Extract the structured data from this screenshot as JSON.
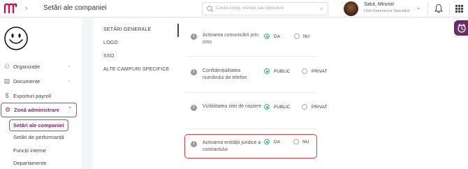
{
  "header": {
    "title": "Setări ale companiei",
    "search_placeholder": "Caută coleg, echipe sau obiective",
    "greeting": "Salut, Miruna!",
    "role": "User Experience Specialist"
  },
  "sidebar": {
    "items": [
      {
        "label": "Organizație",
        "icon": "people-icon"
      },
      {
        "label": "Documente",
        "icon": "document-icon"
      },
      {
        "label": "Exporturi payroll",
        "icon": "dollar-icon"
      },
      {
        "label": "Zonă administrare",
        "icon": "gear-icon"
      }
    ],
    "subitems": [
      "Setări ale companiei",
      "Setări de performanță",
      "Funcții interne",
      "Departamente"
    ]
  },
  "tabs": [
    "SETĂRI GENERALE",
    "LOGO",
    "SSO",
    "ALTE CAMPURI SPECIFICE"
  ],
  "settings": [
    {
      "label": "Activarea comunicării prin sms",
      "options": [
        "DA",
        "NU"
      ],
      "selected": 0
    },
    {
      "label": "Confidențialitatea numărului de telefon",
      "options": [
        "PUBLIC",
        "PRIVAT"
      ],
      "selected": 0
    },
    {
      "label": "Vizibilitatea zilei de naștere",
      "options": [
        "PUBLIC",
        "PRIVAT"
      ],
      "selected": 0
    },
    {
      "label": "Activarea entității juridice a contractului",
      "options": [
        "DA",
        "NU"
      ],
      "selected": 0
    }
  ],
  "colors": {
    "brand": "#6d2a66",
    "accent": "#2fb58a",
    "highlight": "#d64242"
  }
}
